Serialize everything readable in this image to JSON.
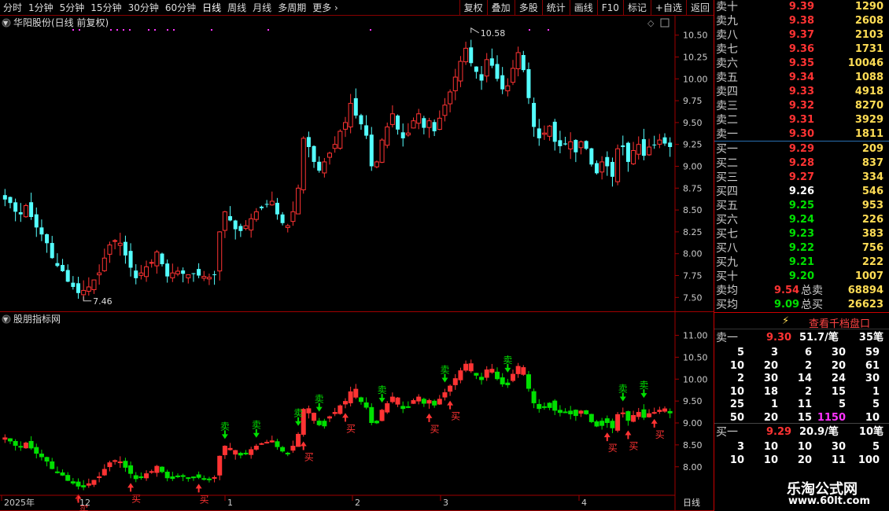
{
  "topbar": {
    "tabs": [
      "分时",
      "1分钟",
      "5分钟",
      "15分钟",
      "30分钟",
      "60分钟",
      "日线",
      "周线",
      "月线",
      "多周期",
      "更多"
    ],
    "active_tab": "日线",
    "right_buttons": [
      "复权",
      "叠加",
      "多股",
      "统计",
      "画线",
      "F10",
      "标记",
      "+自选",
      "返回"
    ]
  },
  "main": {
    "title": "华阳股份(日线 前复权)",
    "high_label": "10.58",
    "low_label": "7.46",
    "y_ticks": [
      "10.50",
      "10.25",
      "10.00",
      "9.75",
      "9.50",
      "9.25",
      "9.00",
      "8.75",
      "8.50",
      "8.25",
      "8.00",
      "7.75",
      "7.50"
    ]
  },
  "indicator": {
    "title": "股朋指标网",
    "y_ticks": [
      "11.00",
      "10.50",
      "10.00",
      "9.50",
      "9.00",
      "8.50",
      "8.00"
    ],
    "buy_label": "买",
    "sell_label": "卖"
  },
  "xaxis": {
    "labels": [
      "2025年",
      "12",
      "1",
      "2",
      "3",
      "4"
    ],
    "period": "日线"
  },
  "orderbook": {
    "asks": [
      {
        "label": "卖十",
        "price": "9.39",
        "vol": "1290"
      },
      {
        "label": "卖九",
        "price": "9.38",
        "vol": "2608"
      },
      {
        "label": "卖八",
        "price": "9.37",
        "vol": "2103"
      },
      {
        "label": "卖七",
        "price": "9.36",
        "vol": "1731"
      },
      {
        "label": "卖六",
        "price": "9.35",
        "vol": "10046"
      },
      {
        "label": "卖五",
        "price": "9.34",
        "vol": "1088"
      },
      {
        "label": "卖四",
        "price": "9.33",
        "vol": "4918"
      },
      {
        "label": "卖三",
        "price": "9.32",
        "vol": "8270"
      },
      {
        "label": "卖二",
        "price": "9.31",
        "vol": "3929"
      },
      {
        "label": "卖一",
        "price": "9.30",
        "vol": "1811"
      }
    ],
    "bids": [
      {
        "label": "买一",
        "price": "9.29",
        "vol": "209"
      },
      {
        "label": "买二",
        "price": "9.28",
        "vol": "837"
      },
      {
        "label": "买三",
        "price": "9.27",
        "vol": "334"
      },
      {
        "label": "买四",
        "price": "9.26",
        "vol": "546"
      },
      {
        "label": "买五",
        "price": "9.25",
        "vol": "953"
      },
      {
        "label": "买六",
        "price": "9.24",
        "vol": "226"
      },
      {
        "label": "买七",
        "price": "9.23",
        "vol": "383"
      },
      {
        "label": "买八",
        "price": "9.22",
        "vol": "756"
      },
      {
        "label": "买九",
        "price": "9.21",
        "vol": "222"
      },
      {
        "label": "买十",
        "price": "9.20",
        "vol": "1007"
      }
    ],
    "ask_avg": {
      "label": "卖均",
      "price": "9.54",
      "total_label": "总卖",
      "total": "68894"
    },
    "bid_avg": {
      "label": "买均",
      "price": "9.09",
      "total_label": "总买",
      "total": "26623"
    },
    "view_thousand": "查看千档盘口",
    "sell1": {
      "label": "卖一",
      "price": "9.30",
      "per": "51.7/笔",
      "count": "35笔"
    },
    "sell1_qty": [
      [
        "5",
        "3",
        "6",
        "30",
        "59"
      ],
      [
        "10",
        "20",
        "2",
        "20",
        "61"
      ],
      [
        "2",
        "30",
        "14",
        "24",
        "30"
      ],
      [
        "10",
        "18",
        "2",
        "15",
        "1"
      ],
      [
        "25",
        "1",
        "11",
        "5",
        "5"
      ],
      [
        "50",
        "20",
        "15",
        "1150",
        "10"
      ]
    ],
    "buy1": {
      "label": "买一",
      "price": "9.29",
      "per": "20.9/笔",
      "count": "10笔"
    },
    "buy1_qty": [
      [
        "3",
        "10",
        "10",
        "30",
        "5"
      ],
      [
        "10",
        "10",
        "20",
        "11",
        "100"
      ]
    ]
  },
  "watermark": {
    "name": "乐淘公式网",
    "url": "www.60lt.com"
  },
  "colors": {
    "up": "#ff3333",
    "down": "#54ffff",
    "green": "#00e000",
    "magenta": "#ff33ff",
    "border": "#a00000",
    "yellow": "#ffdd55"
  },
  "chart_data": {
    "type": "candlestick",
    "title": "华阳股份(日线 前复权)",
    "ylim": [
      7.35,
      10.65
    ],
    "y_ticks": [
      7.5,
      7.75,
      8.0,
      8.25,
      8.5,
      8.75,
      9.0,
      9.25,
      9.5,
      9.75,
      10.0,
      10.25,
      10.5
    ],
    "x_labels": [
      "2025年",
      "12",
      "1",
      "2",
      "3",
      "4"
    ],
    "high": 10.58,
    "low": 7.46,
    "closes": [
      8.62,
      8.58,
      8.48,
      8.45,
      8.55,
      8.42,
      8.3,
      8.22,
      8.12,
      7.95,
      7.86,
      7.8,
      7.68,
      7.62,
      7.55,
      7.58,
      7.62,
      7.7,
      7.78,
      7.95,
      8.1,
      8.15,
      8.12,
      7.98,
      7.84,
      7.72,
      7.78,
      7.85,
      7.9,
      8.02,
      7.88,
      7.74,
      7.78,
      7.8,
      7.77,
      7.76,
      7.77,
      7.75,
      7.74,
      7.73,
      7.76,
      8.25,
      8.48,
      8.38,
      8.28,
      8.26,
      8.32,
      8.4,
      8.48,
      8.52,
      8.56,
      8.6,
      8.45,
      8.35,
      8.32,
      8.48,
      8.75,
      9.32,
      9.22,
      9.05,
      8.95,
      9.05,
      9.15,
      9.25,
      9.4,
      9.5,
      9.72,
      9.58,
      9.48,
      9.35,
      9.0,
      9.05,
      9.3,
      9.45,
      9.6,
      9.42,
      9.32,
      9.38,
      9.52,
      9.6,
      9.44,
      9.52,
      9.4,
      9.55,
      9.7,
      9.85,
      10.02,
      10.2,
      10.35,
      10.18,
      10.08,
      9.98,
      10.22,
      10.15,
      10.0,
      9.88,
      9.92,
      10.12,
      10.3,
      10.1,
      9.78,
      9.45,
      9.32,
      9.38,
      9.46,
      9.28,
      9.23,
      9.25,
      9.28,
      9.16,
      9.28,
      9.2,
      9.02,
      8.92,
      9.05,
      9.0,
      8.88,
      9.2,
      9.22,
      9.05,
      9.18,
      9.25,
      9.12,
      9.22,
      9.24,
      9.3,
      9.26,
      9.22
    ],
    "signals": [
      {
        "type": "sell",
        "index": 42
      },
      {
        "type": "sell",
        "index": 48
      },
      {
        "type": "buy",
        "index": 14
      },
      {
        "type": "buy",
        "index": 24
      },
      {
        "type": "buy",
        "index": 37
      },
      {
        "type": "buy",
        "index": 57
      },
      {
        "type": "sell",
        "index": 56
      },
      {
        "type": "sell",
        "index": 60
      },
      {
        "type": "buy",
        "index": 65
      },
      {
        "type": "sell",
        "index": 72
      },
      {
        "type": "buy",
        "index": 81
      },
      {
        "type": "buy",
        "index": 85
      },
      {
        "type": "sell",
        "index": 84
      },
      {
        "type": "sell",
        "index": 96
      },
      {
        "type": "buy",
        "index": 115
      },
      {
        "type": "buy",
        "index": 119
      },
      {
        "type": "sell",
        "index": 118
      },
      {
        "type": "sell",
        "index": 122
      },
      {
        "type": "buy",
        "index": 124
      }
    ]
  }
}
